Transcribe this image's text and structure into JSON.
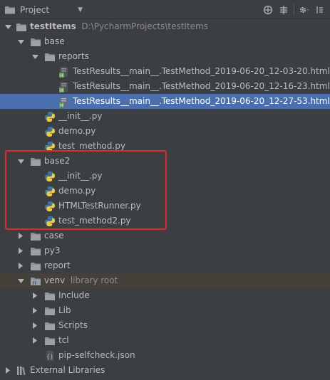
{
  "toolbar": {
    "title": "Project",
    "dropdown_icon": "chevron-down-icon",
    "buttons": [
      "globe-icon",
      "collapse-icon",
      "gear-icon",
      "hide-icon"
    ]
  },
  "tree": {
    "root": {
      "name": "testItems",
      "path": "D:\\PycharmProjects\\testItems"
    },
    "base": {
      "name": "base",
      "reports": {
        "name": "reports",
        "files": [
          "TestResults__main__.TestMethod_2019-06-20_12-03-20.html",
          "TestResults__main__.TestMethod_2019-06-20_12-16-23.html",
          "TestResults__main__.TestMethod_2019-06-20_12-27-53.html"
        ]
      },
      "files": [
        "__init__.py",
        "demo.py",
        "test_method.py"
      ]
    },
    "base2": {
      "name": "base2",
      "files": [
        "__init__.py",
        "demo.py",
        "HTMLTestRunner.py",
        "test_method2.py"
      ]
    },
    "case": "case",
    "py3": "py3",
    "report": "report",
    "venv": {
      "name": "venv",
      "hint": "library root",
      "children": [
        "Include",
        "Lib",
        "Scripts",
        "tcl"
      ],
      "file": "pip-selfcheck.json"
    },
    "external": "External Libraries"
  },
  "colors": {
    "background": "#3c3f41",
    "selection": "#4b6eaf",
    "venv_highlight": "#44413a",
    "annotation_box": "#e3282a",
    "folder": "#8a9199",
    "python_blue": "#3b77a8",
    "python_yellow": "#f5cc37",
    "html_green": "#629755"
  }
}
